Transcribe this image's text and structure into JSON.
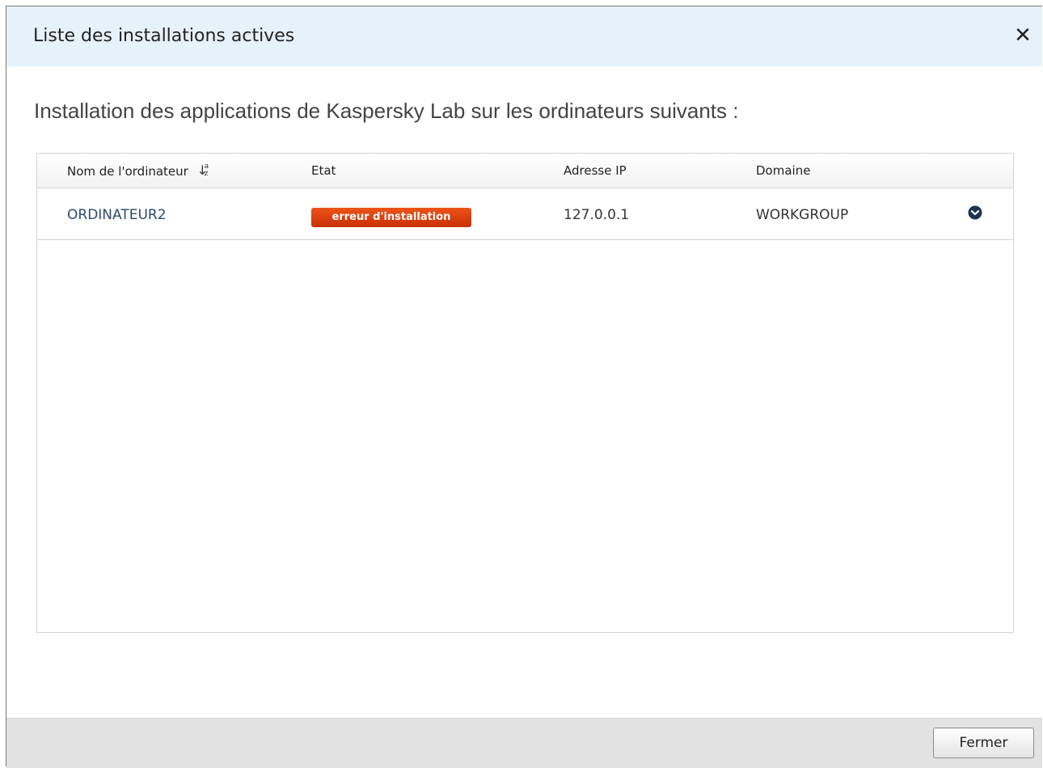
{
  "dialog": {
    "title": "Liste des installations actives",
    "close_symbol": "✕",
    "subtitle": "Installation des applications de Kaspersky Lab sur les ordinateurs suivants :"
  },
  "table": {
    "columns": [
      {
        "label": "Nom de l'ordinateur",
        "sort_icon": "sort-az-icon",
        "sorted": "ascending"
      },
      {
        "label": "Etat"
      },
      {
        "label": "Adresse IP"
      },
      {
        "label": "Domaine"
      }
    ],
    "rows": [
      {
        "name": "ORDINATEUR2",
        "status": "erreur d'installation",
        "ip": "127.0.0.1",
        "domain": "WORKGROUP",
        "action_icon": "chevron-down-circle-icon"
      }
    ]
  },
  "footer": {
    "close_label": "Fermer"
  },
  "colors": {
    "titlebar_bg": "#e6f2fa",
    "status_error": "#d63a08",
    "link_blue": "#2b4a6f",
    "footer_bg": "#e2e2e2",
    "expand_icon": "#1c3550"
  }
}
